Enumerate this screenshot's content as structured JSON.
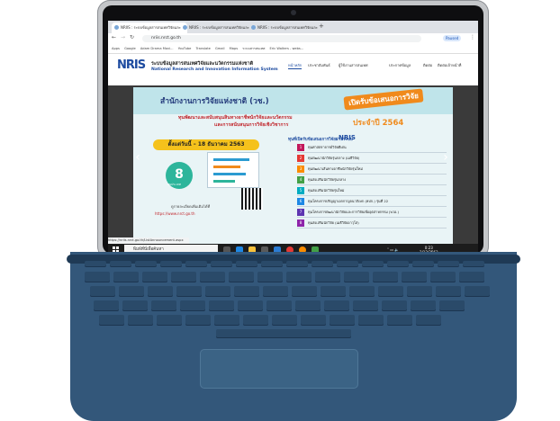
{
  "browser": {
    "tabs": [
      {
        "label": "NRIIS : ระบบข้อมูลสารสนเทศวิจัยและ"
      },
      {
        "label": "NRIIS : ระบบข้อมูลสารสนเทศวิจัยและ"
      },
      {
        "label": "NRIIS : ระบบข้อมูลสารสนเทศวิจัยและ"
      }
    ],
    "address": "nriis.nrct.go.th",
    "paused_label": "Paused",
    "bookmarks": [
      "Apps",
      "Google",
      "Adam Drama Movi...",
      "YouTube",
      "Translate",
      "Gmail",
      "Maps",
      "ระบบสารสนเทศ",
      "Eric Walters - webs..."
    ],
    "status_url": "https://nriis.nrct.go.th/ListAnnouncement.aspx"
  },
  "site": {
    "logo": "NRIS",
    "title_th": "ระบบข้อมูลสารสนเทศวิจัยและนวัตกรรมแห่งชาติ",
    "title_en": "National Research and Innovation Information System",
    "nav": [
      "หน้าหลัก",
      "ประชาสัมพันธ์",
      "ผู้ใช้งานสารสนเทศ",
      "ประกาศข้อมูล",
      "ติดต่อ",
      "ติดต่อเจ้าหน้าที่"
    ]
  },
  "banner": {
    "office": "สำนักงานการวิจัยแห่งชาติ (วช.)",
    "proposal_tag": "เปิดรับข้อเสนอการวิจัย",
    "sub_line1": "ทุนพัฒนาและสนับสนุนสินทางอาชีพนักวิจัยและนวัตกรรม",
    "sub_line2": "และการสนับสนุนการวิจัยเชิงวิชาการ",
    "year": "ประจำปี 2564",
    "deadline": "ตั้งแต่วันนี้ – 18 ธันวาคม 2563",
    "badge_number": "8",
    "badge_label": "ทุนประเภท",
    "more_info": "ดูรายละเอียดเพิ่มเติมได้ที่",
    "url": "https://www.nrct.go.th",
    "funds_title": "ทุนที่เปิดรับข้อเสนอการวิจัยผ่านระบบ",
    "funds_logo": "NRIS",
    "funds": [
      {
        "name": "ทุนศาสตราจารย์วิจัยดีเด่น",
        "color": "#c2185b"
      },
      {
        "name": "ทุนพัฒนานักวิจัยรุ่นกลาง (เมธีวิจัย)",
        "color": "#e53935"
      },
      {
        "name": "ทุนพัฒนาเส้นทางอาชีพนักวิจัยรุ่นใหม่",
        "color": "#fb8c00"
      },
      {
        "name": "ทุนส่งเสริมนักวิจัยรุ่นกลาง",
        "color": "#43a047"
      },
      {
        "name": "ทุนส่งเสริมนักวิจัยรุ่นใหม่",
        "color": "#00acc1"
      },
      {
        "name": "ทุนโครงการปริญญาเอกกาญจนาภิเษก (คปก.) รุ่นที่ 22",
        "color": "#1e88e5"
      },
      {
        "name": "ทุนโครงการพัฒนานักวิจัยและการวิจัยเพื่ออุตสาหกรรม (พวอ.)",
        "color": "#5e35b1"
      },
      {
        "name": "ทุนส่งเสริมนักวิจัย (เมธีวิจัยอาวุโส)",
        "color": "#8e24aa"
      }
    ]
  },
  "taskbar": {
    "search_placeholder": "พิมพ์ที่นี่เพื่อค้นหา",
    "time": "0:23",
    "date": "2/12/2563",
    "icons": [
      "task-view",
      "edge",
      "file-explorer",
      "store",
      "mail",
      "chrome",
      "firefox",
      "app"
    ]
  }
}
